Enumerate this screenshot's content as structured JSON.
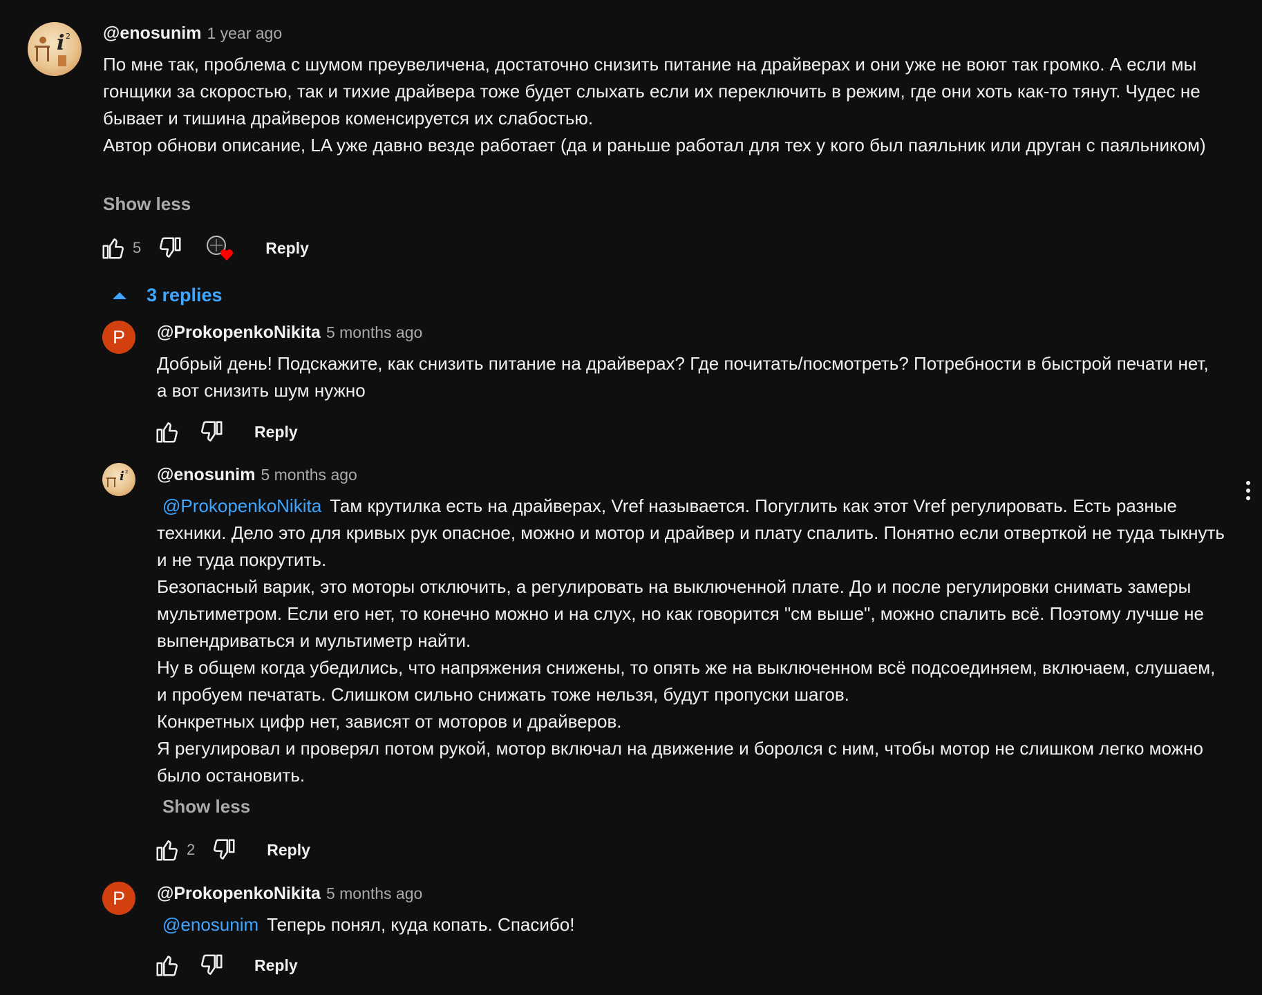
{
  "comment": {
    "author": "@enosunim",
    "time": "1 year ago",
    "text": [
      "По мне так, проблема с шумом преувеличена, достаточно снизить питание на драйверах и они уже не воют так громко. А если мы гонщики за скоростью, так и тихие драйвера тоже будет слыхать если их переключить в режим, где они хоть как-то тянут. Чудес не бывает и тишина драйверов коменсируется их слабостью.",
      "Автор обнови описание, LA уже давно везде работает (да и раньше работал для тех у кого был паяльник или друган с паяльником)"
    ],
    "show_less": "Show less",
    "likes": "5",
    "reply": "Reply"
  },
  "replies_toggle": "3 replies",
  "replies": [
    {
      "author": "@ProkopenkoNikita",
      "avatar_letter": "P",
      "time": "5 months ago",
      "text": [
        "Добрый день! Подскажите, как снизить питание на драйверах? Где почитать/посмотреть? Потребности в быстрой печати нет, а вот снизить шум нужно"
      ],
      "reply": "Reply"
    },
    {
      "author": "@enosunim",
      "time": "5 months ago",
      "mention": "@ProkopenkoNikita",
      "text": [
        "Там крутилка есть на драйверах, Vref называется. Погуглить как этот Vref регулировать. Есть разные техники. Дело это для кривых рук опасное, можно и мотор и драйвер и плату спалить. Понятно если отверткой не туда тыкнуть и не туда покрутить.",
        "Безопасный варик, это моторы отключить, а регулировать на выключенной плате. До и после регулировки снимать замеры мультиметром. Если его нет, то конечно можно и на слух, но как говорится \"см выше\", можно спалить всё. Поэтому лучше не выпендриваться и мультиметр найти.",
        "Ну в общем когда убедились, что напряжения снижены, то опять же на выключенном всё подсоединяем, включаем, слушаем, и пробуем печатать. Слишком сильно снижать тоже нельзя, будут пропуски шагов.",
        "Конкретных цифр нет, зависят от моторов и драйверов.",
        "Я регулировал и проверял потом рукой, мотор включал на движение и боролся с ним, чтобы мотор не слишком легко можно было остановить."
      ],
      "show_less": "Show less",
      "likes": "2",
      "reply": "Reply"
    },
    {
      "author": "@ProkopenkoNikita",
      "avatar_letter": "P",
      "time": "5 months ago",
      "mention": "@enosunim",
      "text": [
        "Теперь понял, куда копать. Спасибо!"
      ],
      "reply": "Reply"
    }
  ],
  "colors": {
    "background": "#0f0f0f",
    "link": "#3ea6ff",
    "avatar_p": "#d3400f",
    "heart": "#ff0000"
  },
  "icons": [
    "thumb-up-icon",
    "thumb-down-icon",
    "creator-heart-icon",
    "caret-up-icon",
    "more-vert-icon"
  ]
}
